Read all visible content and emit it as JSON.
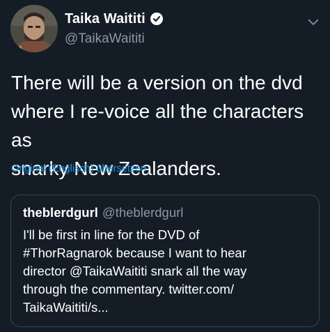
{
  "tweet": {
    "author": {
      "display_name": "Taika Waititi",
      "handle": "@TaikaWaititi",
      "verified": true,
      "avatar_icon": "profile-photo"
    },
    "menu_icon": "chevron-down-icon",
    "text_lines": [
      "There will be a version on the dvd",
      "where I re-voice all the characters as",
      "snarky New Zealanders."
    ],
    "translate_label": "Original (Englisch) übersetzen"
  },
  "quoted_tweet": {
    "display_name": "theblerdgurl",
    "handle": "@theblerdgurl",
    "text_lines": [
      "I'll be first in line for the DVD of",
      "#ThorRagnarok because I want to hear",
      "director @TaikaWaititi snark all the way",
      "through the commentary. twitter.com/",
      "TaikaWaititi/s..."
    ]
  },
  "colors": {
    "background": "#141d26",
    "primary_text": "#ffffff",
    "secondary_text": "#8899a6",
    "link": "#1b95e0",
    "border": "#38444d",
    "verified_badge": "#ffffff"
  }
}
